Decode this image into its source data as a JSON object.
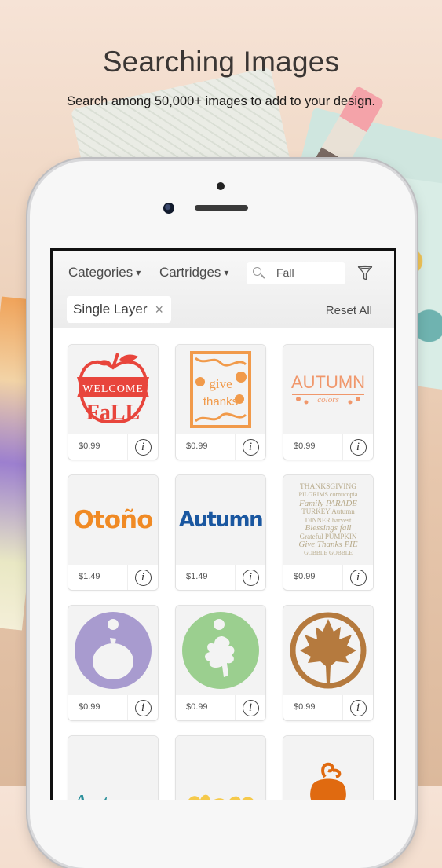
{
  "promo": {
    "title": "Searching Images",
    "subtitle": "Search among 50,000+ images to add to your design."
  },
  "toolbar": {
    "categories_label": "Categories",
    "cartridges_label": "Cartridges",
    "caret": "▾",
    "search_value": "Fall",
    "search_icon": "magnifier-icon",
    "filter_icon": "funnel-icon",
    "active_filter": {
      "label": "Single Layer",
      "remove_glyph": "×"
    },
    "reset_label": "Reset All"
  },
  "colors": {
    "accent_red": "#e8453c",
    "accent_orange": "#f19a4a",
    "autumn_peach": "#f0976b",
    "otono_orange": "#f08a24",
    "autumn_blue": "#1a57a0",
    "word_cloud_tan": "#b8ab8c",
    "tag_purple": "#a89bcf",
    "tag_green": "#9bcf8f",
    "maple_brown": "#b57a3e",
    "teal": "#2a8f9a",
    "yellow": "#f5c94a",
    "pumpkin": "#e06a10"
  },
  "images": [
    {
      "name": "Welcome Fall apple",
      "price": "$0.99",
      "art_text": [
        "WELCOME",
        "FaLL"
      ]
    },
    {
      "name": "Give Thanks frame",
      "price": "$0.99",
      "art_text": [
        "give",
        "thanks"
      ]
    },
    {
      "name": "Autumn Colors",
      "price": "$0.99",
      "art_text": [
        "AUTUMN",
        "colors"
      ]
    },
    {
      "name": "Otoño",
      "price": "$1.49",
      "art_text": [
        "Otoño"
      ]
    },
    {
      "name": "Autumn",
      "price": "$1.49",
      "art_text": [
        "Autumn"
      ]
    },
    {
      "name": "Thanksgiving word cloud",
      "price": "$0.99",
      "art_text": [
        "THANKSGIVING",
        "PILGRIMS cornucopia",
        "Family PARADE",
        "TURKEY Autumn",
        "DINNER harvest",
        "Blessings fall",
        "Grateful PUMPKIN",
        "Give Thanks PIE",
        "GOBBLE GOBBLE"
      ]
    },
    {
      "name": "Pumpkin tag",
      "price": "$0.99"
    },
    {
      "name": "Oak leaf tag",
      "price": "$0.99"
    },
    {
      "name": "Maple leaf circle",
      "price": "$0.99"
    },
    {
      "name": "Autumn script",
      "price": "",
      "art_text": [
        "Autumn"
      ]
    },
    {
      "name": "Leaves border",
      "price": ""
    },
    {
      "name": "Pumpkin",
      "price": ""
    }
  ],
  "info_glyph": "i"
}
